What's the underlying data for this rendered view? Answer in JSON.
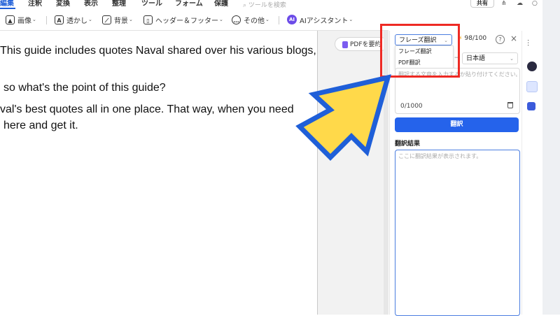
{
  "menu": {
    "items": [
      "編集",
      "注釈",
      "変換",
      "表示",
      "整理",
      "ツール",
      "フォーム",
      "保護"
    ],
    "search_placeholder": "ツールを検索",
    "share_label": "共有"
  },
  "toolbar": {
    "image": "画像",
    "watermark": "透かし",
    "background": "背景",
    "header_footer": "ヘッダー＆フッター",
    "others": "その他",
    "ai_assistant": "AIアシスタント",
    "ai_badge": "AI"
  },
  "document": {
    "lines": [
      "This guide includes quotes Naval shared over his various blogs,",
      "so what's the point of this guide?",
      "val's best quotes all in one place. That way, when you need",
      "here and get it."
    ],
    "summarize_button": "PDFを要約"
  },
  "panel": {
    "mode_selected": "フレーズ翻訳",
    "mode_options": [
      "フレーズ翻訳",
      "PDF翻訳"
    ],
    "credits": "98/100",
    "target_language": "日本語",
    "source_placeholder": "翻訳する文章を入力するか貼り付けてください。",
    "char_count": "0/1000",
    "translate_button": "翻訳",
    "result_label": "翻訳結果",
    "result_placeholder": "ここに翻訳結果が表示されます。"
  },
  "colors": {
    "accent": "#2563eb",
    "highlight": "#ee2a24",
    "arrow_fill": "#ffd94a",
    "arrow_stroke": "#1f5fd8"
  }
}
